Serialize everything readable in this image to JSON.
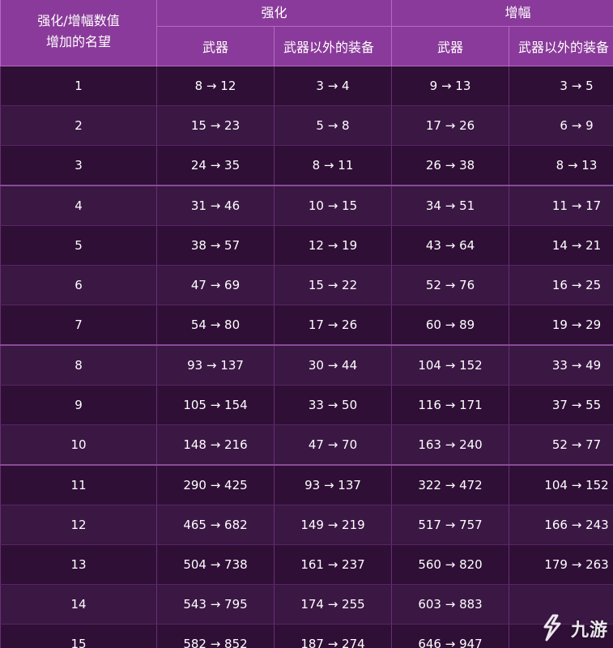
{
  "header": {
    "corner_line1": "强化/增幅数值",
    "corner_line2": "增加的名望",
    "group_strengthen": "强化",
    "group_amplify": "增幅",
    "sub_weapon": "武器",
    "sub_other": "武器以外的装备"
  },
  "rows": [
    {
      "level": "1",
      "s_weapon": "8 → 12",
      "s_other": "3 → 4",
      "a_weapon": "9 → 13",
      "a_other": "3 → 5"
    },
    {
      "level": "2",
      "s_weapon": "15 → 23",
      "s_other": "5 → 8",
      "a_weapon": "17 → 26",
      "a_other": "6 → 9"
    },
    {
      "level": "3",
      "s_weapon": "24 → 35",
      "s_other": "8 → 11",
      "a_weapon": "26 → 38",
      "a_other": "8 → 13"
    },
    {
      "level": "4",
      "s_weapon": "31 → 46",
      "s_other": "10 → 15",
      "a_weapon": "34 → 51",
      "a_other": "11 → 17"
    },
    {
      "level": "5",
      "s_weapon": "38 → 57",
      "s_other": "12 → 19",
      "a_weapon": "43 → 64",
      "a_other": "14 → 21"
    },
    {
      "level": "6",
      "s_weapon": "47 → 69",
      "s_other": "15 → 22",
      "a_weapon": "52 → 76",
      "a_other": "16 → 25"
    },
    {
      "level": "7",
      "s_weapon": "54 → 80",
      "s_other": "17 → 26",
      "a_weapon": "60 → 89",
      "a_other": "19 → 29"
    },
    {
      "level": "8",
      "s_weapon": "93 → 137",
      "s_other": "30 → 44",
      "a_weapon": "104 → 152",
      "a_other": "33 → 49"
    },
    {
      "level": "9",
      "s_weapon": "105 → 154",
      "s_other": "33 → 50",
      "a_weapon": "116 → 171",
      "a_other": "37 → 55"
    },
    {
      "level": "10",
      "s_weapon": "148 → 216",
      "s_other": "47 → 70",
      "a_weapon": "163 → 240",
      "a_other": "52 → 77"
    },
    {
      "level": "11",
      "s_weapon": "290 → 425",
      "s_other": "93 → 137",
      "a_weapon": "322 → 472",
      "a_other": "104 → 152"
    },
    {
      "level": "12",
      "s_weapon": "465 → 682",
      "s_other": "149 → 219",
      "a_weapon": "517 → 757",
      "a_other": "166 → 243"
    },
    {
      "level": "13",
      "s_weapon": "504 → 738",
      "s_other": "161 → 237",
      "a_weapon": "560 → 820",
      "a_other": "179 → 263"
    },
    {
      "level": "14",
      "s_weapon": "543 → 795",
      "s_other": "174 → 255",
      "a_weapon": "603 → 883",
      "a_other": ""
    },
    {
      "level": "15",
      "s_weapon": "582 → 852",
      "s_other": "187 → 274",
      "a_weapon": "646 → 947",
      "a_other": ""
    }
  ],
  "watermark": {
    "text": "九游",
    "icon": "jiuyou-logo-icon",
    "color": "#ffffff"
  },
  "colors": {
    "header_bg": "#8a3a9a",
    "row_odd": "#2f0f36",
    "row_even": "#3b1744"
  }
}
